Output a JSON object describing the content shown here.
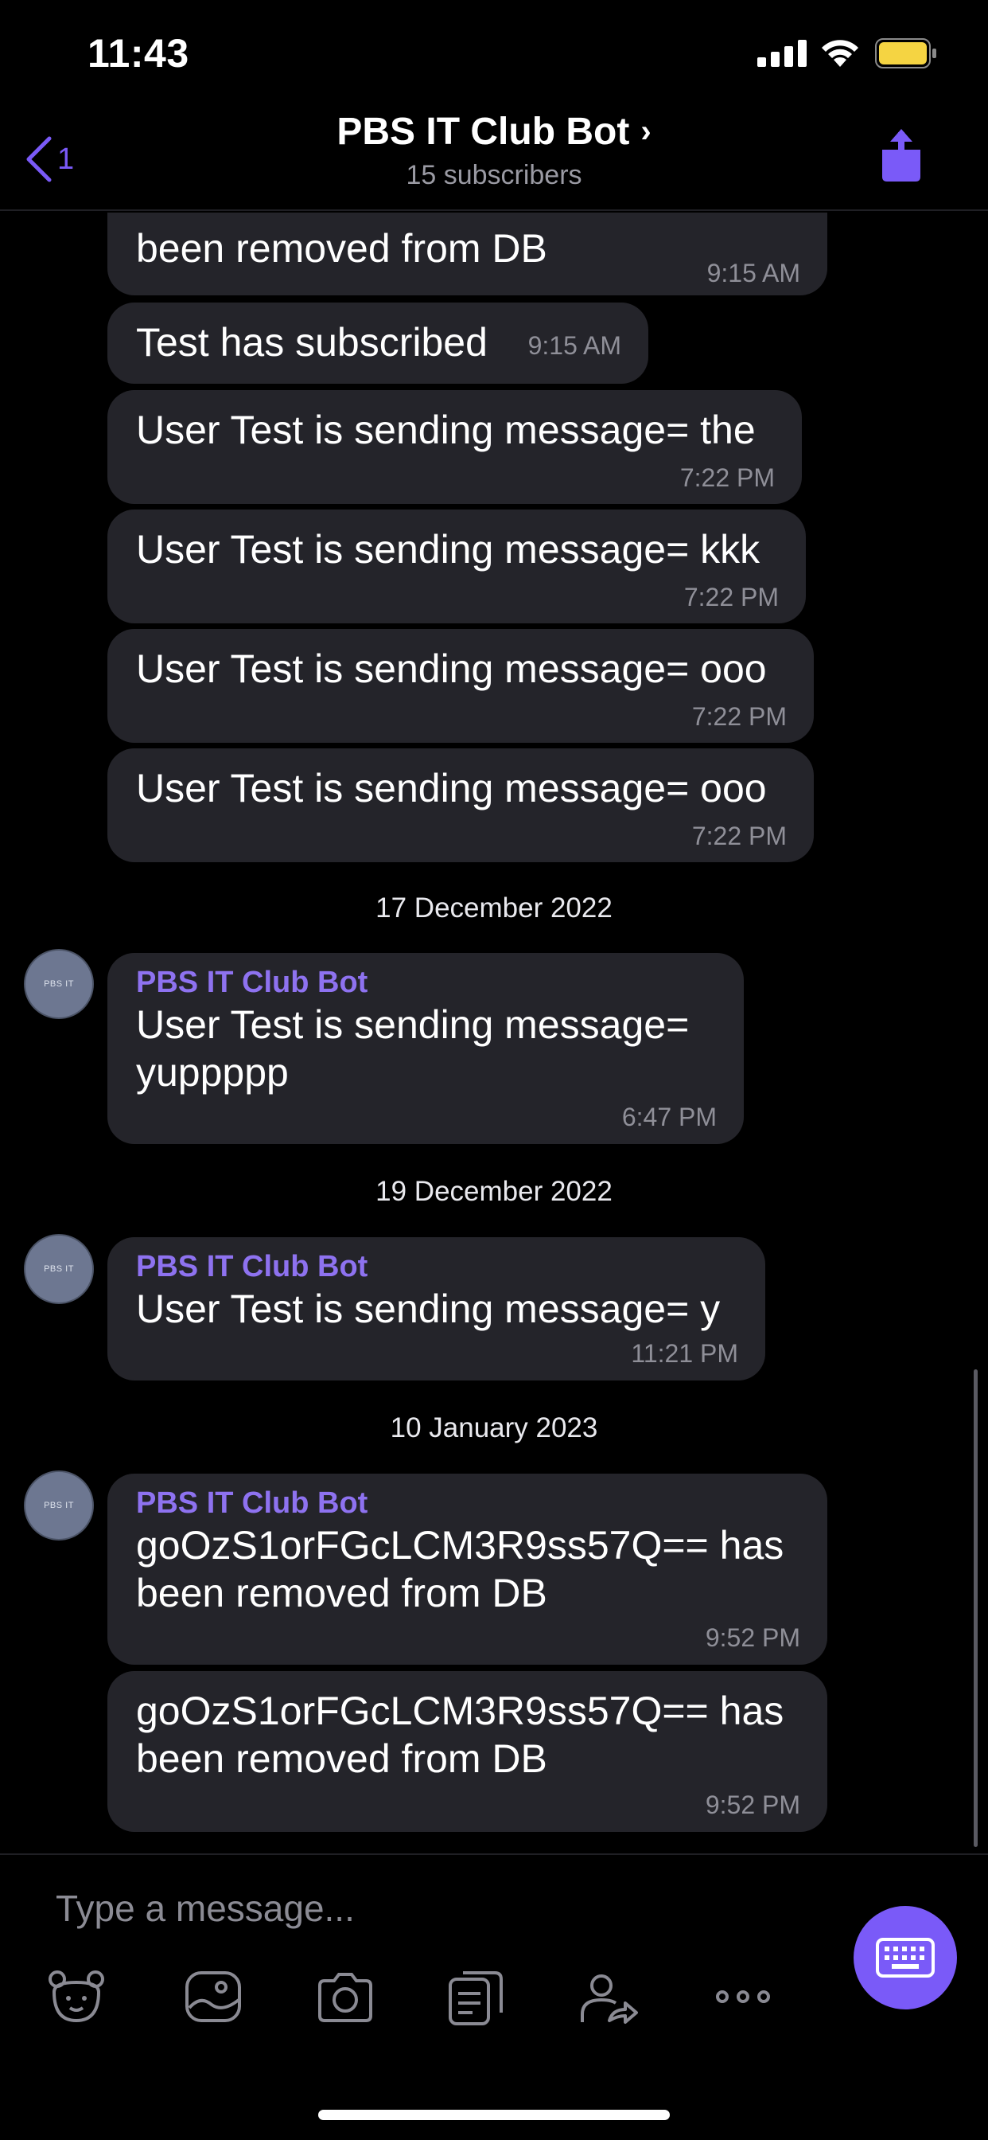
{
  "status_bar": {
    "time": "11:43"
  },
  "header": {
    "back_count": "1",
    "title": "PBS IT Club Bot",
    "chevron": "›",
    "subtitle": "15 subscribers"
  },
  "messages": [
    {
      "text": "been removed from DB",
      "time": "9:15 AM"
    },
    {
      "text": "Test has subscribed",
      "time": "9:15 AM"
    },
    {
      "text": "User Test is sending message= the",
      "time": "7:22 PM"
    },
    {
      "text": "User Test is sending message= kkk",
      "time": "7:22 PM"
    },
    {
      "text": "User Test is sending message= ooo",
      "time": "7:22 PM"
    },
    {
      "text": "User Test is sending message= ooo",
      "time": "7:22 PM"
    },
    {
      "date": "17 December 2022"
    },
    {
      "sender": "PBS IT Club Bot",
      "line1": "User Test is sending message=",
      "line2": "yuppppp",
      "time": "6:47 PM"
    },
    {
      "date": "19 December 2022"
    },
    {
      "sender": "PBS IT Club Bot",
      "text": "User Test is sending message= y",
      "time": "11:21 PM"
    },
    {
      "date": "10 January 2023"
    },
    {
      "sender": "PBS IT Club Bot",
      "line1": "goOzS1orFGcLCM3R9ss57Q== has",
      "line2": "been removed from DB",
      "time": "9:52 PM"
    },
    {
      "line1": "goOzS1orFGcLCM3R9ss57Q== has",
      "line2": "been removed from DB",
      "time": "9:52 PM"
    }
  ],
  "avatar_label": "PBS IT",
  "composer": {
    "placeholder": "Type a message..."
  },
  "toolbar": [
    "sticker-icon",
    "gallery-icon",
    "camera-icon",
    "files-icon",
    "contact-share-icon",
    "more-icon"
  ],
  "colors": {
    "accent": "#7a5af8",
    "sender": "#8e72f0",
    "bubble": "#24242a"
  }
}
